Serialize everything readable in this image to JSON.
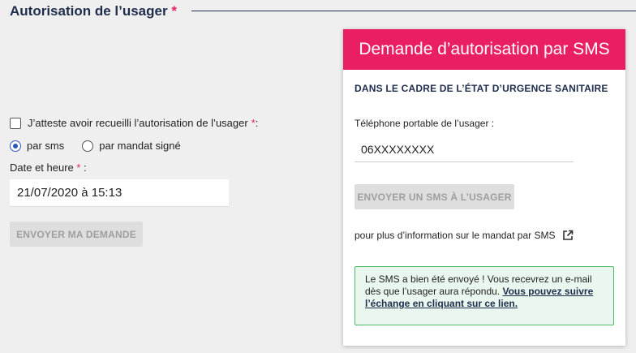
{
  "section": {
    "title": "Autorisation de l’usager",
    "required_marker": "*"
  },
  "form": {
    "attest_label": "J’atteste avoir recueilli l’autorisation de l’usager",
    "attest_required": "*",
    "attest_suffix": " :",
    "attest_checked": false,
    "radio_options": [
      {
        "label": "par sms",
        "checked": true
      },
      {
        "label": "par mandat signé",
        "checked": false
      }
    ],
    "date_label": "Date et heure",
    "date_required": "*",
    "date_suffix": " :",
    "date_value": "21/07/2020 à 15:13",
    "submit_label": "ENVOYER MA DEMANDE"
  },
  "sms_card": {
    "header": "Demande d’autorisation par SMS",
    "subtitle": "DANS LE CADRE DE L’ÉTAT D’URGENCE SANITAIRE",
    "phone_label": "Téléphone portable de l’usager :",
    "phone_value": "06XXXXXXXX",
    "send_label": "ENVOYER UN SMS À L’USAGER",
    "info_text": "pour plus d’information sur le mandat par SMS",
    "info_icon": "external-link-icon",
    "alert_text": "Le SMS a bien été envoyé ! Vous recevrez un e-mail dès que l’usager aura répondu.",
    "alert_link": "Vous pouvez suivre l’échange en cliquant sur ce lien."
  },
  "colors": {
    "accent": "#e91e63",
    "navy": "#1f2d4d",
    "radio": "#2c56b8",
    "success_border": "#4cbc6a",
    "success_bg": "#eaf7ee"
  }
}
